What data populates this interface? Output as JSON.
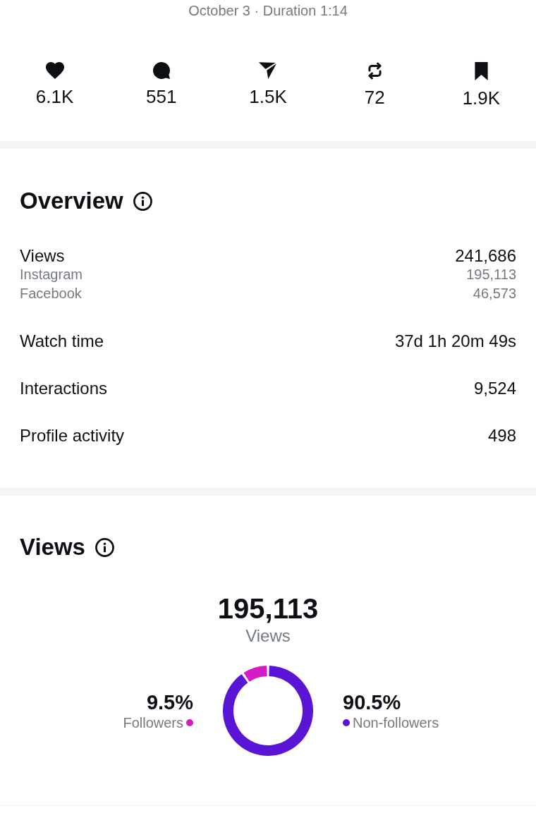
{
  "header": {
    "meta": "October 3 · Duration 1:14"
  },
  "stats": [
    {
      "kind": "likes",
      "value": "6.1K"
    },
    {
      "kind": "comments",
      "value": "551"
    },
    {
      "kind": "shares",
      "value": "1.5K"
    },
    {
      "kind": "reposts",
      "value": "72"
    },
    {
      "kind": "saves",
      "value": "1.9K"
    }
  ],
  "overview": {
    "title": "Overview",
    "metrics": [
      {
        "label": "Views",
        "value": "241,686",
        "breakdown": [
          {
            "label": "Instagram",
            "value": "195,113"
          },
          {
            "label": "Facebook",
            "value": "46,573"
          }
        ]
      },
      {
        "label": "Watch time",
        "value": "37d 1h 20m 49s"
      },
      {
        "label": "Interactions",
        "value": "9,524"
      },
      {
        "label": "Profile activity",
        "value": "498"
      }
    ]
  },
  "views": {
    "title": "Views",
    "total": "195,113",
    "total_label": "Views",
    "legend": [
      {
        "value": "9.5%",
        "color": "#d41bc5"
      },
      {
        "value": "90.5%",
        "color": "#5a14d6"
      }
    ],
    "chart_data": {
      "type": "donut",
      "categories": [
        "Followers",
        "Non-followers"
      ],
      "values": [
        9.5,
        90.5
      ]
    }
  }
}
